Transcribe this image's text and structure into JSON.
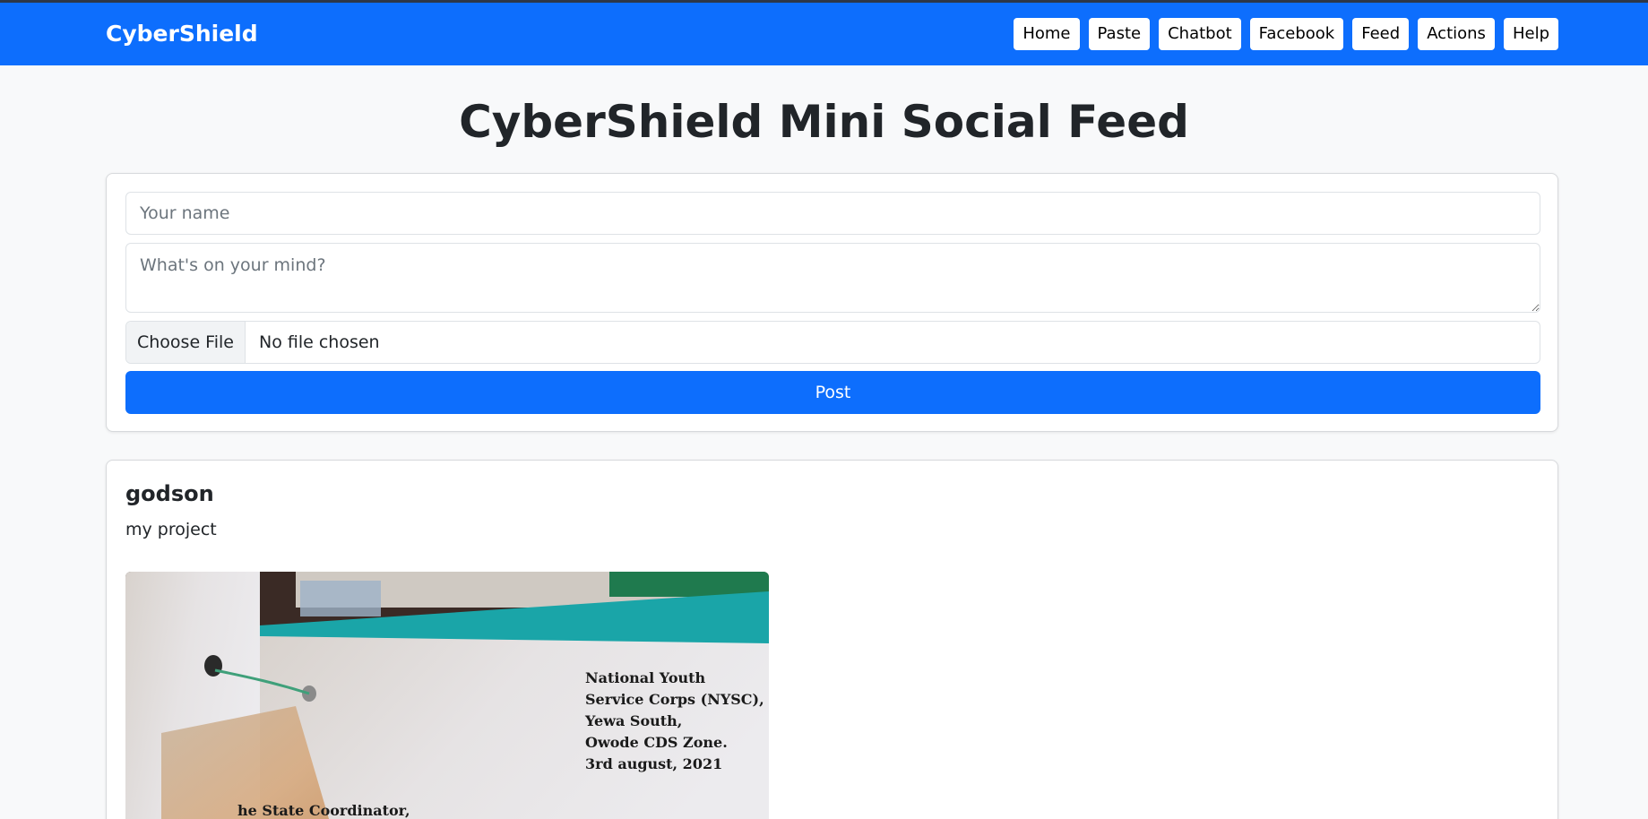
{
  "app": {
    "brand": "CyberShield"
  },
  "nav": {
    "items": [
      {
        "label": "Home"
      },
      {
        "label": "Paste"
      },
      {
        "label": "Chatbot"
      },
      {
        "label": "Facebook"
      },
      {
        "label": "Feed"
      },
      {
        "label": "Actions"
      },
      {
        "label": "Help"
      }
    ]
  },
  "page": {
    "title": "CyberShield Mini Social Feed"
  },
  "compose": {
    "name_placeholder": "Your name",
    "name_value": "",
    "message_placeholder": "What's on your mind?",
    "message_value": "",
    "choose_file_label": "Choose File",
    "file_status": "No file chosen",
    "post_label": "Post"
  },
  "posts": [
    {
      "author": "godson",
      "text": "my project",
      "image": {
        "address_lines": [
          "National Youth",
          "Service Corps (NYSC),",
          "Yewa South,",
          "Owode CDS Zone.",
          "3rd august, 2021"
        ],
        "salutation": "he State Coordinator,"
      }
    }
  ],
  "colors": {
    "primary": "#0d6efd",
    "background": "#f8f9fa",
    "text": "#212529",
    "placeholder": "#6c757d"
  }
}
